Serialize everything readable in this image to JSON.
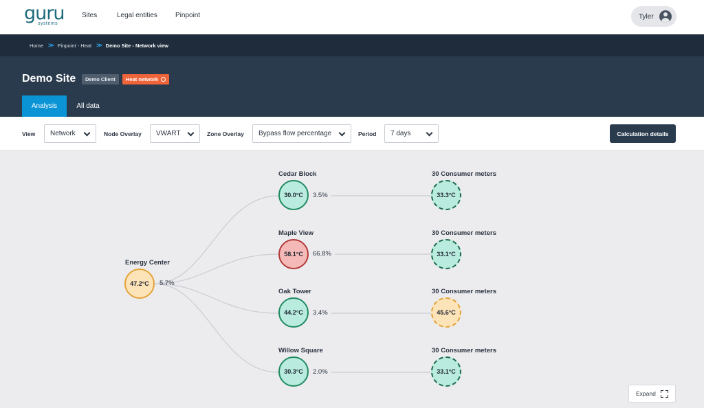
{
  "nav": {
    "logo_text": "guru",
    "logo_sub": "systems",
    "links": [
      "Sites",
      "Legal entities",
      "Pinpoint"
    ],
    "user": "Tyler"
  },
  "breadcrumb": {
    "items": [
      "Home",
      "Pinpoint - Heat",
      "Demo Site - Network view"
    ]
  },
  "header": {
    "title": "Demo Site",
    "badge_client": "Demo Client",
    "badge_type": "Heat network",
    "tabs": [
      "Analysis",
      "All data"
    ]
  },
  "toolbar": {
    "view_label": "View",
    "view_value": "Network",
    "node_overlay_label": "Node Overlay",
    "node_overlay_value": "VWART",
    "zone_overlay_label": "Zone Overlay",
    "zone_overlay_value": "Bypass flow percentage",
    "period_label": "Period",
    "period_value": "7 days",
    "calc_button": "Calculation details"
  },
  "network": {
    "root": {
      "name": "Energy Center",
      "temp": "47.2°C",
      "pct": "5.7%",
      "status": "warm"
    },
    "branches": [
      {
        "name": "Cedar Block",
        "temp": "30.0°C",
        "pct": "3.5%",
        "status": "ok",
        "consumer": {
          "name": "30 Consumer meters",
          "temp": "33.3°C",
          "status": "ok"
        }
      },
      {
        "name": "Maple View",
        "temp": "58.1°C",
        "pct": "66.8%",
        "status": "hot",
        "consumer": {
          "name": "30 Consumer meters",
          "temp": "33.1°C",
          "status": "ok"
        }
      },
      {
        "name": "Oak Tower",
        "temp": "44.2°C",
        "pct": "3.4%",
        "status": "ok",
        "consumer": {
          "name": "30 Consumer meters",
          "temp": "45.6°C",
          "status": "warm"
        }
      },
      {
        "name": "Willow Square",
        "temp": "30.3°C",
        "pct": "2.0%",
        "status": "ok",
        "consumer": {
          "name": "30 Consumer meters",
          "temp": "33.1°C",
          "status": "ok"
        }
      }
    ]
  },
  "expand_label": "Expand"
}
